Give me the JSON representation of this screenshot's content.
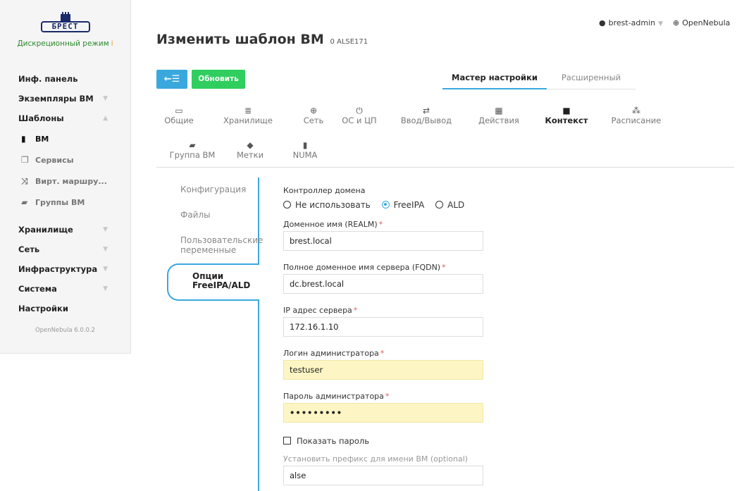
{
  "sidebar": {
    "logo_text": "БРЕСТ",
    "mode": "Дискреционный режим",
    "info_icon": "i",
    "items": [
      {
        "label": "Инф. панель"
      },
      {
        "label": "Экземпляры ВМ"
      },
      {
        "label": "Шаблоны"
      },
      {
        "label": "Хранилище"
      },
      {
        "label": "Сеть"
      },
      {
        "label": "Инфраструктура"
      },
      {
        "label": "Система"
      },
      {
        "label": "Настройки"
      }
    ],
    "sub_items": [
      {
        "label": "ВМ",
        "icon": "file-icon"
      },
      {
        "label": "Сервисы",
        "icon": "files-icon"
      },
      {
        "label": "Вирт. маршру...",
        "icon": "shuffle-icon"
      },
      {
        "label": "Группы ВМ",
        "icon": "folder-open-icon"
      }
    ],
    "version": "OpenNebula 6.0.0.2"
  },
  "header": {
    "title": "Изменить шаблон ВМ",
    "subtitle": "0 ALSE171",
    "user": "brest-admin",
    "zone": "OpenNebula"
  },
  "toolbar": {
    "back_label": "←☰",
    "refresh_label": "Обновить",
    "wizard_tab": "Мастер настройки",
    "advanced_tab": "Расширенный"
  },
  "sections": [
    {
      "label": "Общие",
      "icon": "laptop-icon"
    },
    {
      "label": "Хранилище",
      "icon": "database-icon"
    },
    {
      "label": "Сеть",
      "icon": "globe-icon"
    },
    {
      "label": "ОС и ЦП",
      "icon": "power-icon"
    },
    {
      "label": "Ввод/Вывод",
      "icon": "exchange-icon"
    },
    {
      "label": "Действия",
      "icon": "calendar-icon"
    },
    {
      "label": "Контекст",
      "icon": "folder-icon"
    },
    {
      "label": "Расписание",
      "icon": "sitemap-icon"
    },
    {
      "label": "Группа ВМ",
      "icon": "folder-open-icon"
    },
    {
      "label": "Метки",
      "icon": "tag-icon"
    },
    {
      "label": "NUMA",
      "icon": "chip-icon"
    }
  ],
  "context_tabs": {
    "config": "Конфигурация",
    "files": "Файлы",
    "user_vars_1": "Пользовательские",
    "user_vars_2": "переменные",
    "freeipa_1": "Опции",
    "freeipa_2": "FreeIPA/ALD"
  },
  "form": {
    "domain_controller_label": "Контроллер домена",
    "radio_none": "Не использовать",
    "radio_freeipa": "FreeIPA",
    "radio_ald": "ALD",
    "realm_label": "Доменное имя (REALM)",
    "realm_value": "brest.local",
    "fqdn_label": "Полное доменное имя сервера (FQDN)",
    "fqdn_value": "dc.brest.local",
    "ip_label": "IP адрес сервера",
    "ip_value": "172.16.1.10",
    "login_label": "Логин администратора",
    "login_value": "testuser",
    "password_label": "Пароль администратора",
    "password_value": "•••••••••",
    "show_password_label": "Показать пароль",
    "prefix_label": "Установить префикс для имени ВМ",
    "prefix_optional": "(optional)",
    "prefix_value": "alse",
    "required_mark": "*"
  }
}
